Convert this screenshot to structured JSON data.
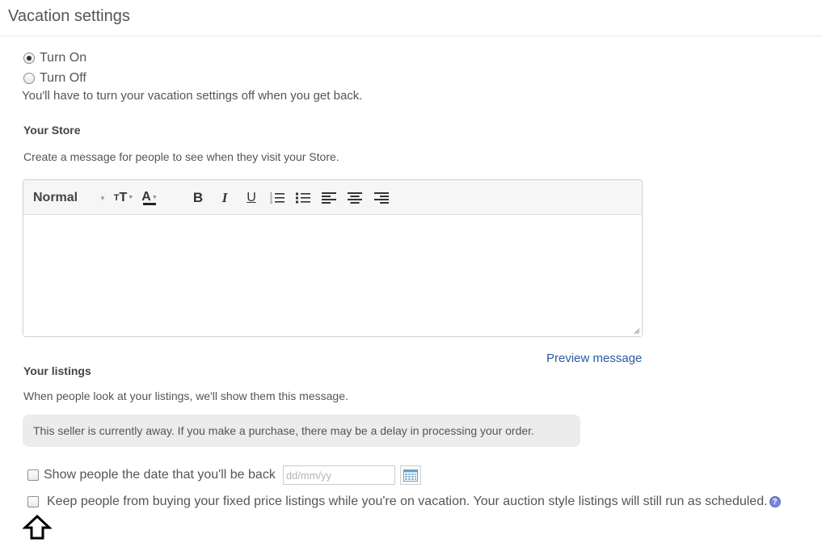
{
  "header": {
    "title": "Vacation settings"
  },
  "vacation_mode": {
    "options": [
      {
        "label": "Turn On",
        "selected": true
      },
      {
        "label": "Turn Off",
        "selected": false
      }
    ],
    "note": "You'll have to turn your vacation settings off when you get back."
  },
  "store": {
    "heading": "Your Store",
    "description": "Create a message for people to see when they visit your Store.",
    "editor": {
      "style_label": "Normal",
      "size_glyph": "T",
      "size_glyph_small": "T",
      "color_glyph": "A",
      "bold": "B",
      "italic": "I",
      "underline": "U",
      "content": ""
    },
    "preview_link": "Preview message"
  },
  "listings": {
    "heading": "Your listings",
    "description": "When people look at your listings, we'll show them this message.",
    "away_message": "This seller is currently away. If you make a purchase, there may be a delay in processing your order.",
    "show_date": {
      "label": "Show people the date that you'll be back",
      "checked": false,
      "placeholder": "dd/mm/yy"
    },
    "keep_buyers": {
      "label": "Keep people from buying your fixed price listings while you're on vacation. Your auction style listings will still run as scheduled.",
      "checked": false,
      "help_glyph": "?"
    }
  },
  "colors": {
    "link": "#2a5aa3",
    "help_badge": "#7a86d8",
    "away_box": "#ececec"
  }
}
